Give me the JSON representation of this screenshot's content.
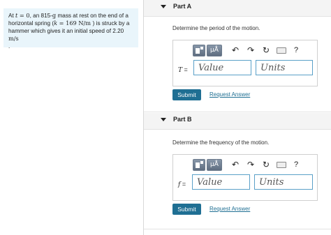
{
  "problem": {
    "segments": [
      {
        "t": "At ",
        "s": "text"
      },
      {
        "t": "t",
        "s": "math"
      },
      {
        "t": " = 0",
        "s": "mathrm"
      },
      {
        "t": ", an 815-",
        "s": "text"
      },
      {
        "t": "g",
        "s": "mathrm"
      },
      {
        "t": " mass at rest on the end of a horizontal spring (",
        "s": "text"
      },
      {
        "t": "k",
        "s": "math"
      },
      {
        "t": " = 169  N/m ",
        "s": "mathrm"
      },
      {
        "t": ") is struck by a hammer which gives it an initial speed of 2.20 ",
        "s": "text"
      },
      {
        "t": "m/s",
        "s": "mathrm"
      }
    ],
    "trailing": "."
  },
  "parts": [
    {
      "title": "Part A",
      "question": "Determine the period of the motion.",
      "variable": "T",
      "equals": "=",
      "value_placeholder": "Value",
      "units_placeholder": "Units",
      "submit_label": "Submit",
      "request_label": "Request Answer"
    },
    {
      "title": "Part B",
      "question": "Determine the frequency of the motion.",
      "variable": "f",
      "equals": "=",
      "value_placeholder": "Value",
      "units_placeholder": "Units",
      "submit_label": "Submit",
      "request_label": "Request Answer"
    }
  ],
  "toolbar": {
    "mu_label": "μÅ",
    "undo_glyph": "↶",
    "redo_glyph": "↷",
    "reset_glyph": "↻",
    "help_label": "?"
  },
  "colors": {
    "problem_bg": "#e9f5fb",
    "accent": "#1f6f93",
    "field_border": "#5aa0c8"
  },
  "icons": [
    "templates-icon",
    "symbols-icon",
    "undo-icon",
    "redo-icon",
    "reset-icon",
    "keyboard-icon",
    "help-icon"
  ]
}
